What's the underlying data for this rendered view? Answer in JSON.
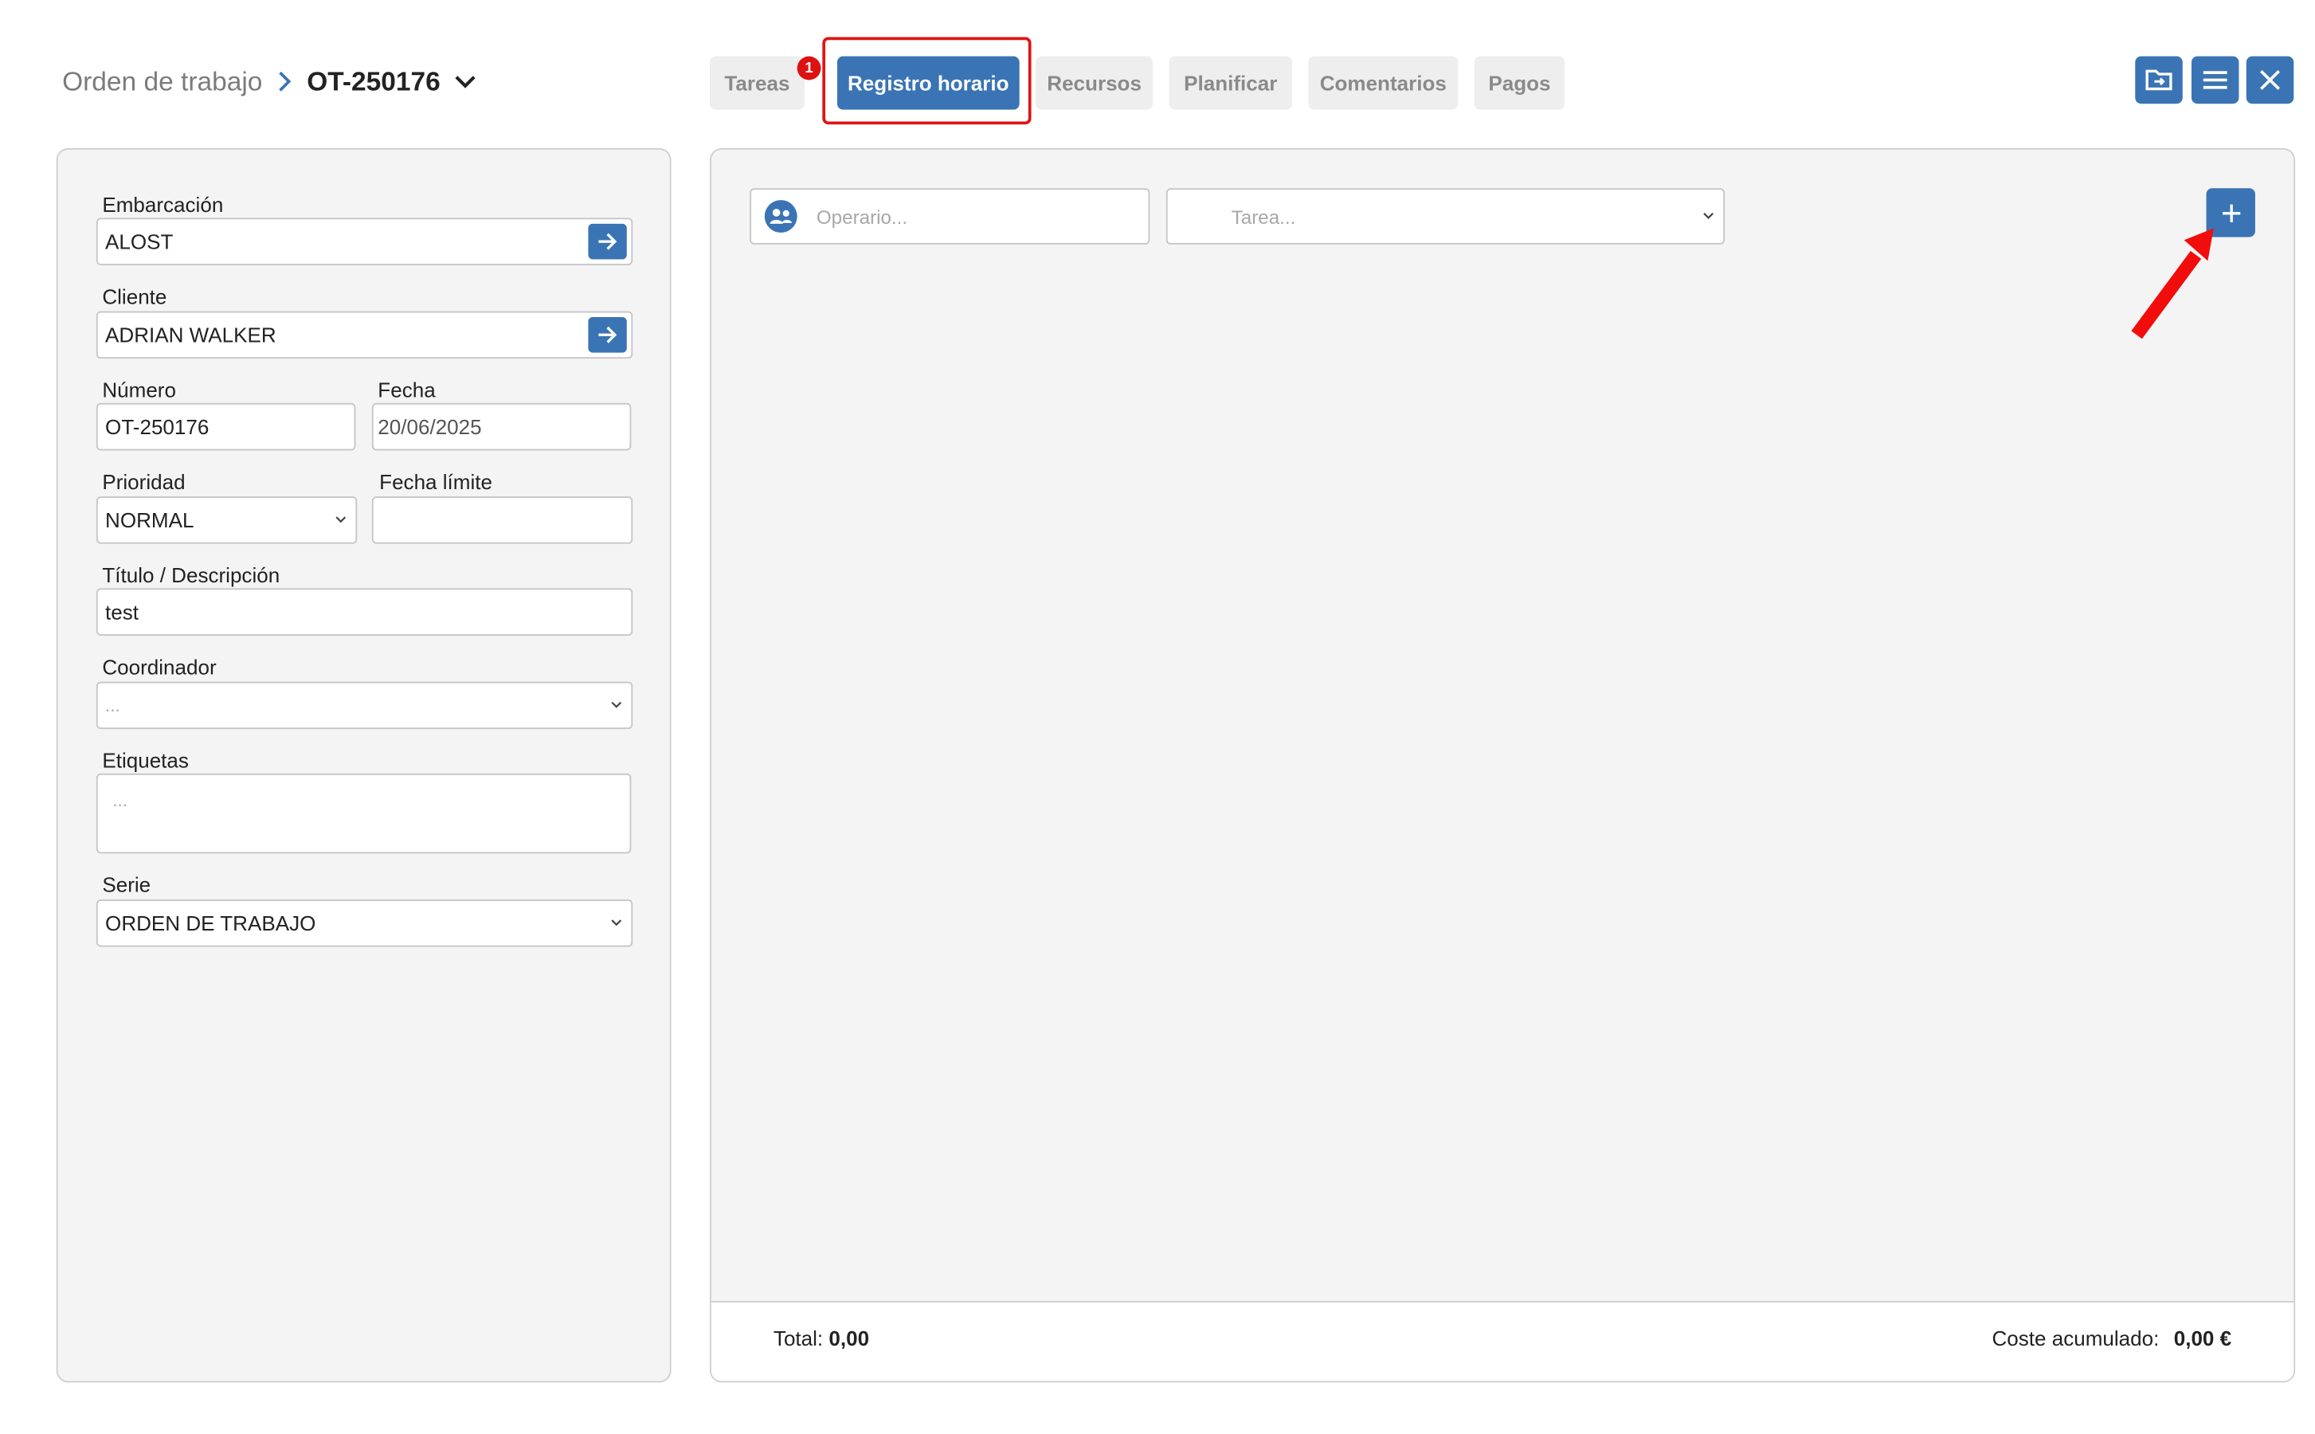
{
  "header": {
    "breadcrumb_root": "Orden de trabajo",
    "breadcrumb_current": "OT-250176",
    "tabs": [
      {
        "label": "Tareas",
        "badge": "1"
      },
      {
        "label": "Registro horario"
      },
      {
        "label": "Recursos"
      },
      {
        "label": "Planificar"
      },
      {
        "label": "Comentarios"
      },
      {
        "label": "Pagos"
      }
    ],
    "active_tab": "Registro horario",
    "buttons": [
      "folder-export-icon",
      "menu-icon",
      "close-icon"
    ]
  },
  "form": {
    "embarcacion": {
      "label": "Embarcación",
      "value": "ALOST"
    },
    "cliente": {
      "label": "Cliente",
      "value": "ADRIAN WALKER"
    },
    "numero": {
      "label": "Número",
      "value": "OT-250176"
    },
    "fecha": {
      "label": "Fecha",
      "value": "20/06/2025"
    },
    "prioridad": {
      "label": "Prioridad",
      "value": "NORMAL"
    },
    "fecha_limite": {
      "label": "Fecha límite",
      "value": ""
    },
    "titulo": {
      "label": "Título / Descripción",
      "value": "test"
    },
    "coordinador": {
      "label": "Coordinador",
      "placeholder": "..."
    },
    "etiquetas": {
      "label": "Etiquetas",
      "placeholder": "..."
    },
    "serie": {
      "label": "Serie",
      "value": "ORDEN DE TRABAJO"
    }
  },
  "time_log": {
    "operario_placeholder": "Operario...",
    "tarea_placeholder": "Tarea...",
    "total_label": "Total:",
    "total_value": "0,00",
    "cost_label": "Coste acumulado:",
    "cost_value": "0,00 €"
  },
  "colors": {
    "accent": "#3a74b4",
    "highlight": "#e01414",
    "panel": "#f4f4f4"
  }
}
